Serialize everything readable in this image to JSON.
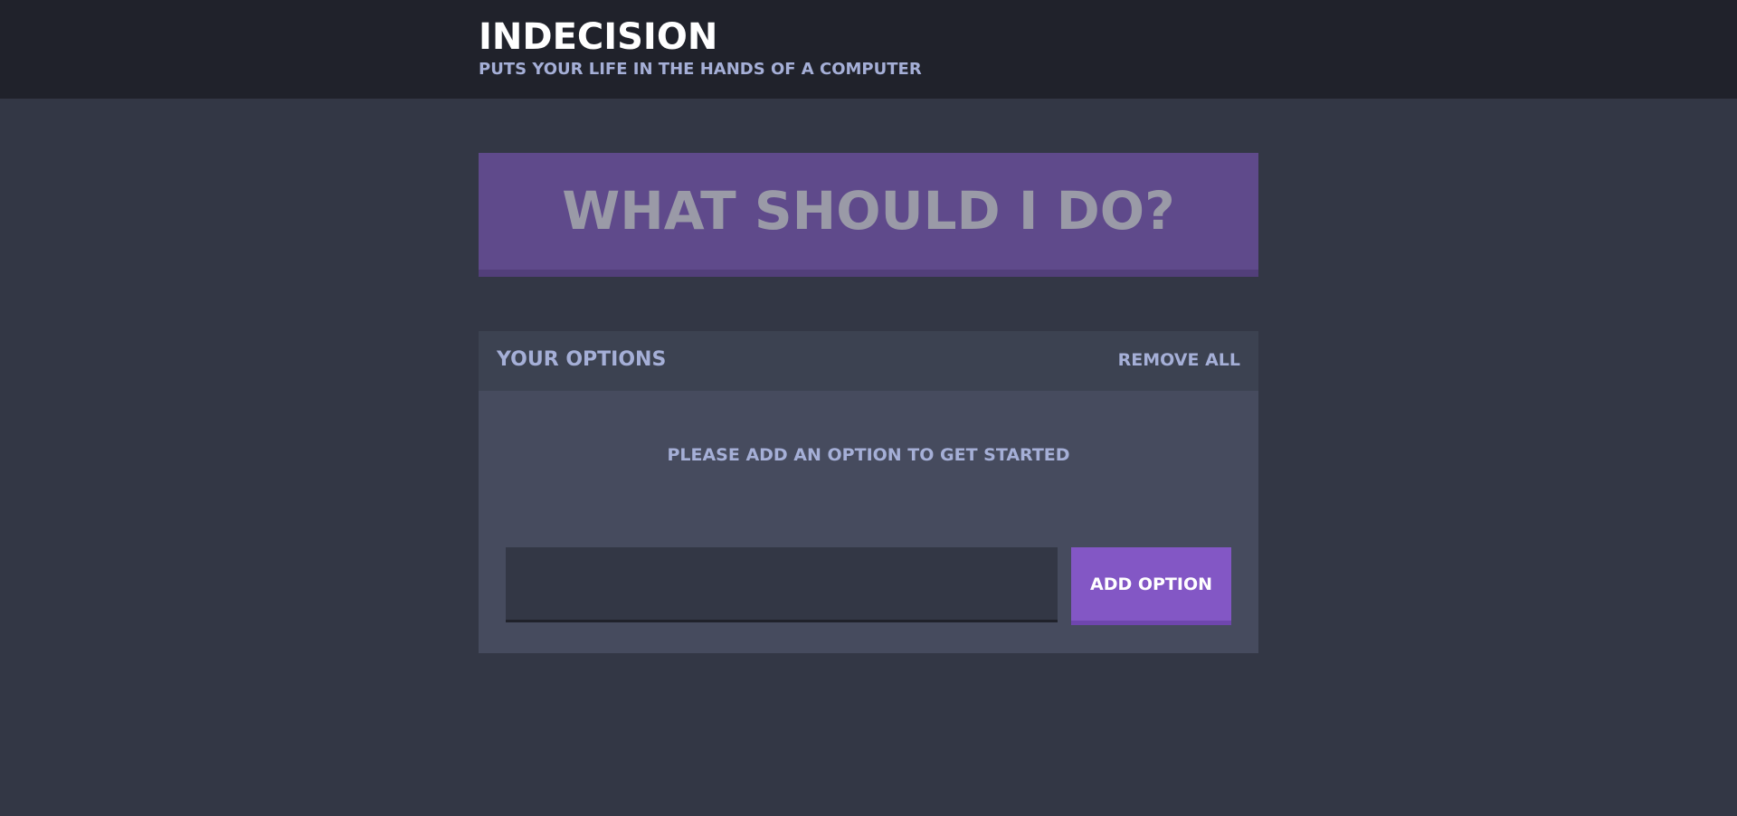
{
  "header": {
    "title": "Indecision",
    "subtitle": "Puts your life in the hands of a computer"
  },
  "action": {
    "label": "What should I do?"
  },
  "options_widget": {
    "title": "Your Options",
    "remove_all_label": "Remove All",
    "empty_message": "Please add an option to get started",
    "input_value": "",
    "add_button_label": "Add Option"
  },
  "colors": {
    "header_bg": "#20222b",
    "page_bg": "#333745",
    "purple": "#5f4a8b",
    "accent": "#8357c5",
    "text_light": "#a5afd7"
  }
}
